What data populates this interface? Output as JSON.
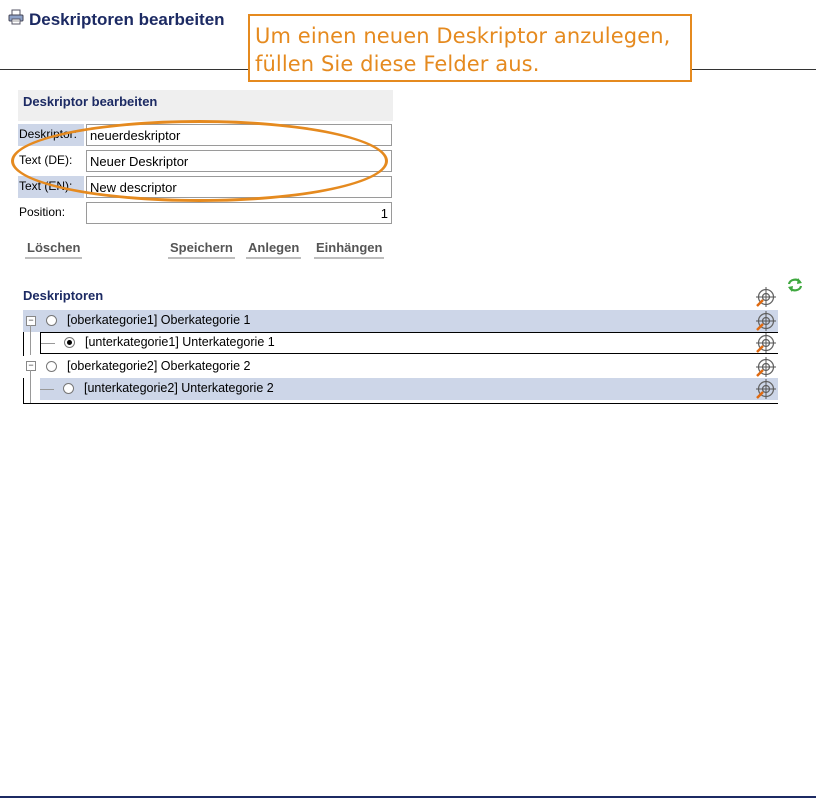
{
  "header": {
    "title": "Deskriptoren bearbeiten",
    "tooltip_line1": "Um einen neuen Deskriptor anzulegen,",
    "tooltip_line2": "füllen Sie diese Felder aus."
  },
  "form": {
    "title": "Deskriptor bearbeiten",
    "fields": [
      {
        "label": "Deskriptor:",
        "value": "neuerdeskriptor"
      },
      {
        "label": "Text (DE):",
        "value": "Neuer Deskriptor"
      },
      {
        "label": "Text (EN):",
        "value": "New descriptor"
      },
      {
        "label": "Position:",
        "value": "1"
      }
    ],
    "buttons": {
      "delete": "Löschen",
      "save": "Speichern",
      "create": "Anlegen",
      "attach": "Einhängen"
    }
  },
  "tree": {
    "title": "Deskriptoren",
    "items": [
      {
        "label": "[oberkategorie1] Oberkategorie 1",
        "level": 0,
        "selected": false
      },
      {
        "label": "[unterkategorie1] Unterkategorie 1",
        "level": 1,
        "selected": true
      },
      {
        "label": "[oberkategorie2] Oberkategorie 2",
        "level": 0,
        "selected": false
      },
      {
        "label": "[unterkategorie2] Unterkategorie 2",
        "level": 1,
        "selected": false
      }
    ]
  },
  "colors": {
    "accent": "#e58a1f",
    "title": "#1c2a63",
    "row_shade": "#cdd6e8"
  },
  "icons": [
    "print-icon",
    "refresh-icon",
    "target-icon",
    "collapse-icon",
    "radio-icon"
  ]
}
